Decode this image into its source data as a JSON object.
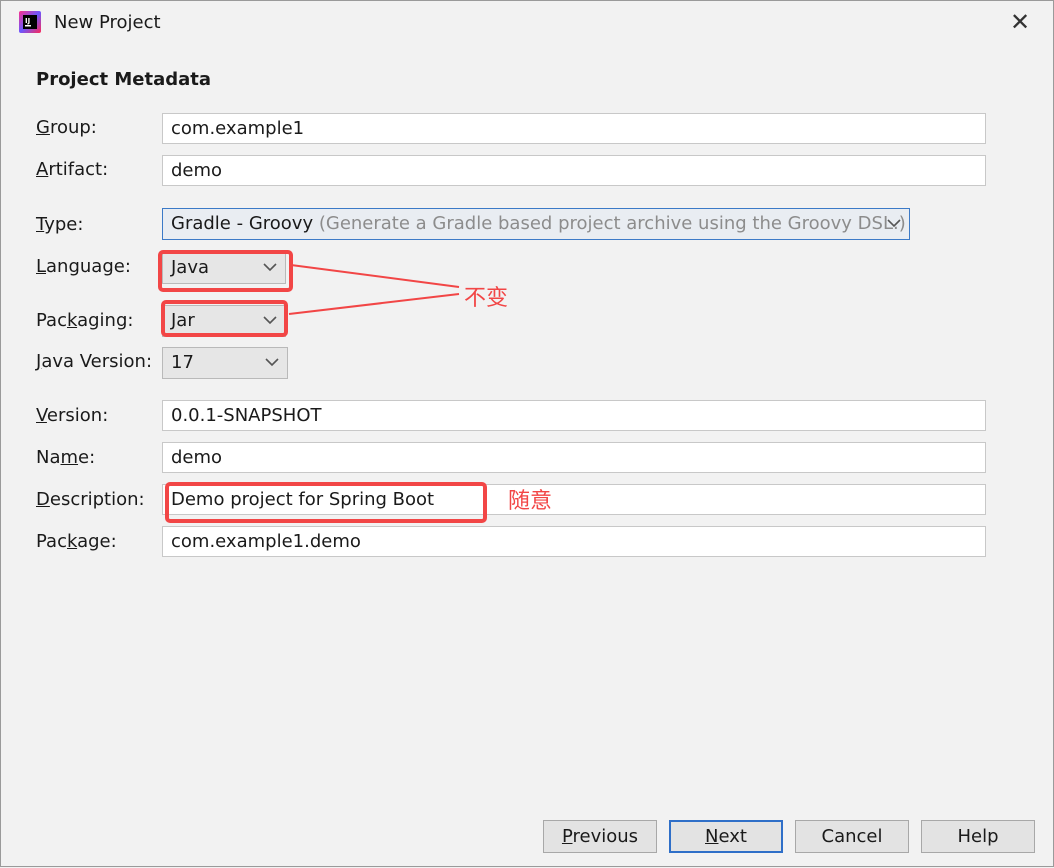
{
  "window": {
    "title": "New Project",
    "close_glyph": "✕",
    "app_icon": "intellij-idea-icon"
  },
  "form": {
    "section_title": "Project Metadata",
    "group": {
      "label_u": "G",
      "label_rest": "roup:",
      "value": "com.example1"
    },
    "artifact": {
      "label_u": "A",
      "label_rest": "rtifact:",
      "value": "demo"
    },
    "type": {
      "label_u": "T",
      "label_rest": "ype:",
      "value": "Gradle - Groovy",
      "hint": "(Generate a Gradle based project archive using the Groovy DSL.)"
    },
    "language": {
      "label_pre": "",
      "label_u": "L",
      "label_rest": "anguage:",
      "value": "Java"
    },
    "packaging": {
      "label_pre": "Pac",
      "label_u": "k",
      "label_rest": "aging:",
      "value": "Jar"
    },
    "java_version": {
      "label_u": "J",
      "label_rest": "ava Version:",
      "value": "17"
    },
    "version": {
      "label_u": "V",
      "label_rest": "ersion:",
      "value": "0.0.1-SNAPSHOT"
    },
    "name": {
      "label_pre": "Na",
      "label_u": "m",
      "label_rest": "e:",
      "value": "demo"
    },
    "description": {
      "label_u": "D",
      "label_rest": "escription:",
      "value": "Demo project for Spring Boot"
    },
    "package": {
      "label_pre": "Pac",
      "label_u": "k",
      "label_rest": "age:",
      "value": "com.example1.demo"
    }
  },
  "annotations": {
    "unchanged": "不变",
    "arbitrary": "随意",
    "color": "#f24646"
  },
  "buttons": {
    "previous": {
      "u": "P",
      "rest": "revious"
    },
    "next": {
      "u": "N",
      "rest": "ext"
    },
    "cancel": "Cancel",
    "help": "Help"
  },
  "colors": {
    "background": "#f2f2f2",
    "default_button_border": "#2f6fc8",
    "annotation": "#f24646"
  }
}
